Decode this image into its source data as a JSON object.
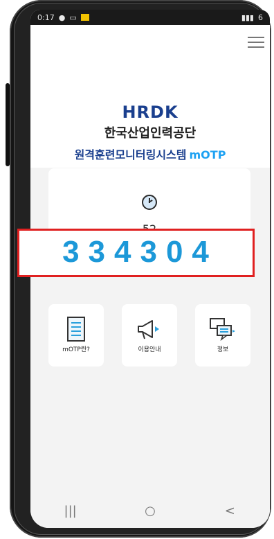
{
  "statusbar": {
    "time": "0:17",
    "right": "6"
  },
  "app": {
    "logo": "HRDK",
    "organization": "한국산업인력공단",
    "system_title": "원격훈련모니터링시스템",
    "system_suffix": "mOTP"
  },
  "otp": {
    "timer": "52",
    "code": "334304"
  },
  "tiles": [
    {
      "label": "mOTP란?",
      "icon": "document-icon"
    },
    {
      "label": "이용안내",
      "icon": "megaphone-icon"
    },
    {
      "label": "정보",
      "icon": "chat-bubbles-icon"
    }
  ],
  "navbar": {
    "recent": "|||",
    "home": "○",
    "back": "<"
  },
  "colors": {
    "brand": "#1a3f8e",
    "otp": "#1c98d8",
    "highlight": "#e02020"
  }
}
